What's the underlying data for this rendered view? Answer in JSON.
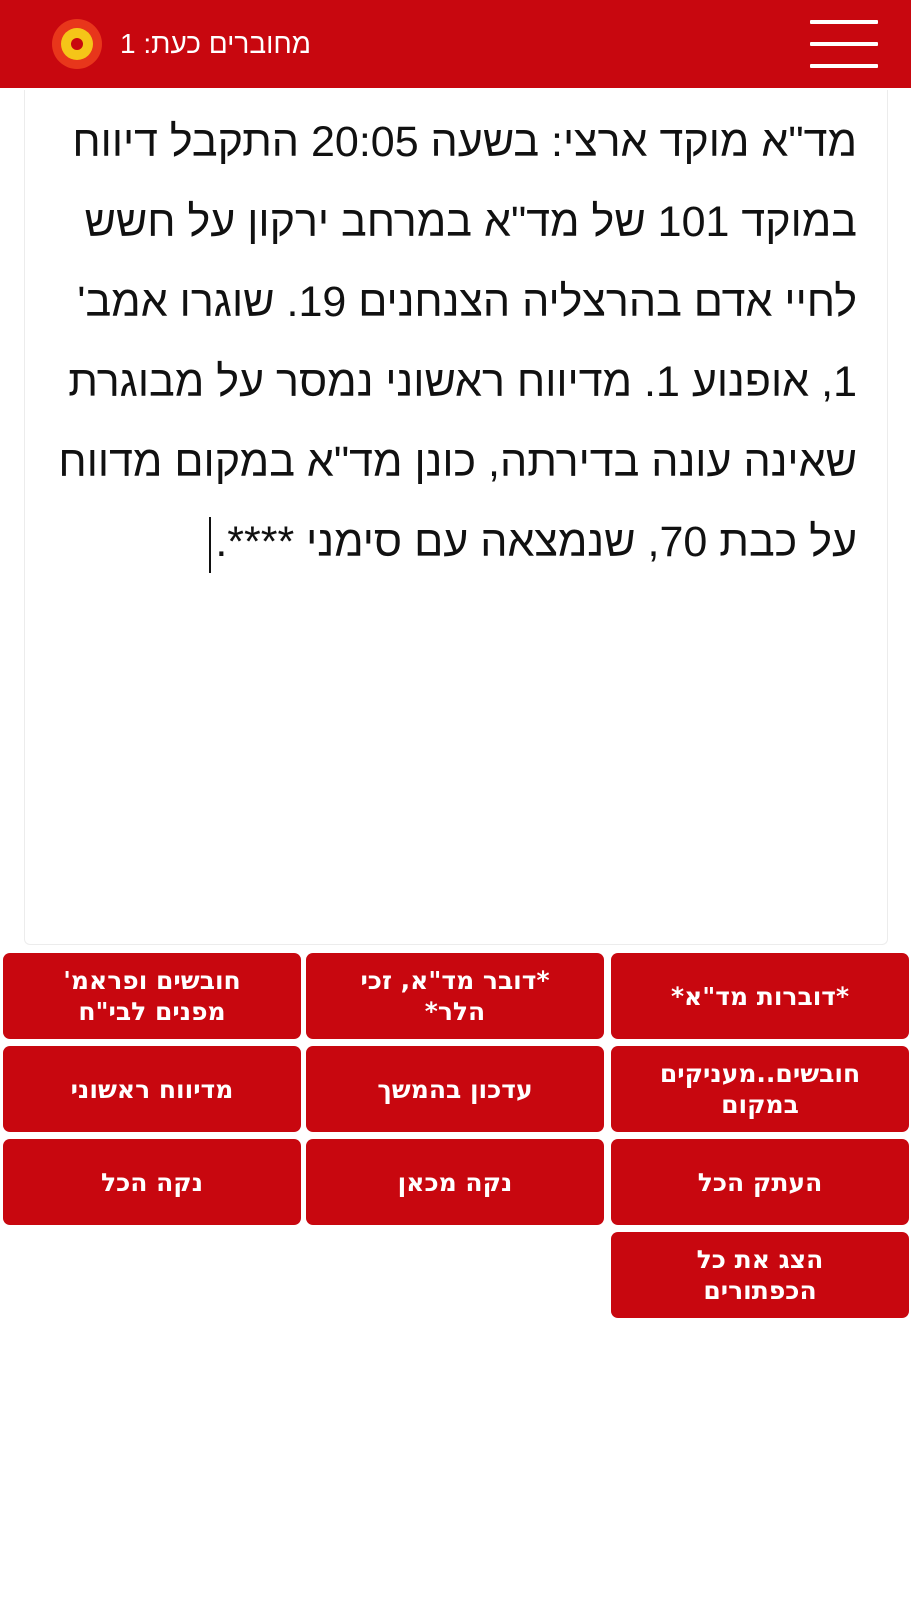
{
  "header": {
    "menu_icon": "hamburger-menu-icon",
    "status_icon": "online-status-dot-icon",
    "online_label": "מחוברים כעת: 1",
    "colors": {
      "bar": "#c8070f",
      "status_outer": "#e8361b",
      "status_ring": "#f5c518"
    }
  },
  "editor": {
    "text": "מד\"א מוקד ארצי: בשעה 20:05 התקבל דיווח במוקד 101 של מד\"א במרחב ירקון על חשש לחיי אדם בהרצליה הצנחנים 19. שוגרו אמב' 1, אופנוע 1. מדיווח ראשוני נמסר על מבוגרת שאינה עונה בדירתה, כונן מד\"א במקום מדווח על כבת 70, שנמצאה עם סימני ****."
  },
  "buttons": [
    {
      "label": "*דוברות מד\"א*"
    },
    {
      "label": "*דובר מד\"א, זכי הלר*"
    },
    {
      "label": "חובשים ופראמ' מפנים לבי\"ח"
    },
    {
      "label": "חובשים..מעניקים במקום"
    },
    {
      "label": "עדכון בהמשך"
    },
    {
      "label": "מדיווח ראשוני"
    },
    {
      "label": "העתק הכל"
    },
    {
      "label": "נקה מכאן"
    },
    {
      "label": "נקה הכל"
    },
    {
      "label": "הצג את כל הכפתורים"
    }
  ],
  "theme": {
    "accent": "#c8070f",
    "button_text": "#ffffff"
  }
}
